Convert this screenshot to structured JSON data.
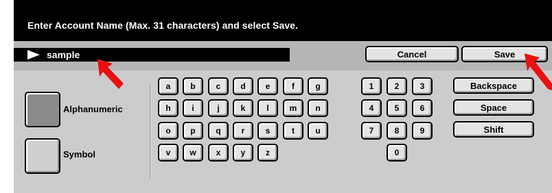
{
  "header": {
    "instruction": "Enter Account Name (Max. 31 characters) and select Save."
  },
  "name_field": {
    "value": "sample"
  },
  "actions": {
    "cancel_label": "Cancel",
    "save_label": "Save"
  },
  "modes": {
    "alphanumeric_label": "Alphanumeric",
    "symbol_label": "Symbol"
  },
  "letter_keys": {
    "row1": [
      "a",
      "b",
      "c",
      "d",
      "e",
      "f",
      "g"
    ],
    "row2": [
      "h",
      "i",
      "j",
      "k",
      "l",
      "m",
      "n"
    ],
    "row3": [
      "o",
      "p",
      "q",
      "r",
      "s",
      "t",
      "u"
    ],
    "row4": [
      "v",
      "w",
      "x",
      "y",
      "z"
    ]
  },
  "number_keys": {
    "row1": [
      "1",
      "2",
      "3"
    ],
    "row2": [
      "4",
      "5",
      "6"
    ],
    "row3": [
      "7",
      "8",
      "9"
    ],
    "row4": [
      "0"
    ]
  },
  "function_keys": {
    "backspace_label": "Backspace",
    "space_label": "Space",
    "shift_label": "Shift"
  },
  "colors": {
    "header_bg": "#000000",
    "panel_bg": "#cccccc",
    "strip_bg": "#b6b6b6",
    "pointer": "#e81010",
    "selected_mode": "#8a8a8a"
  }
}
